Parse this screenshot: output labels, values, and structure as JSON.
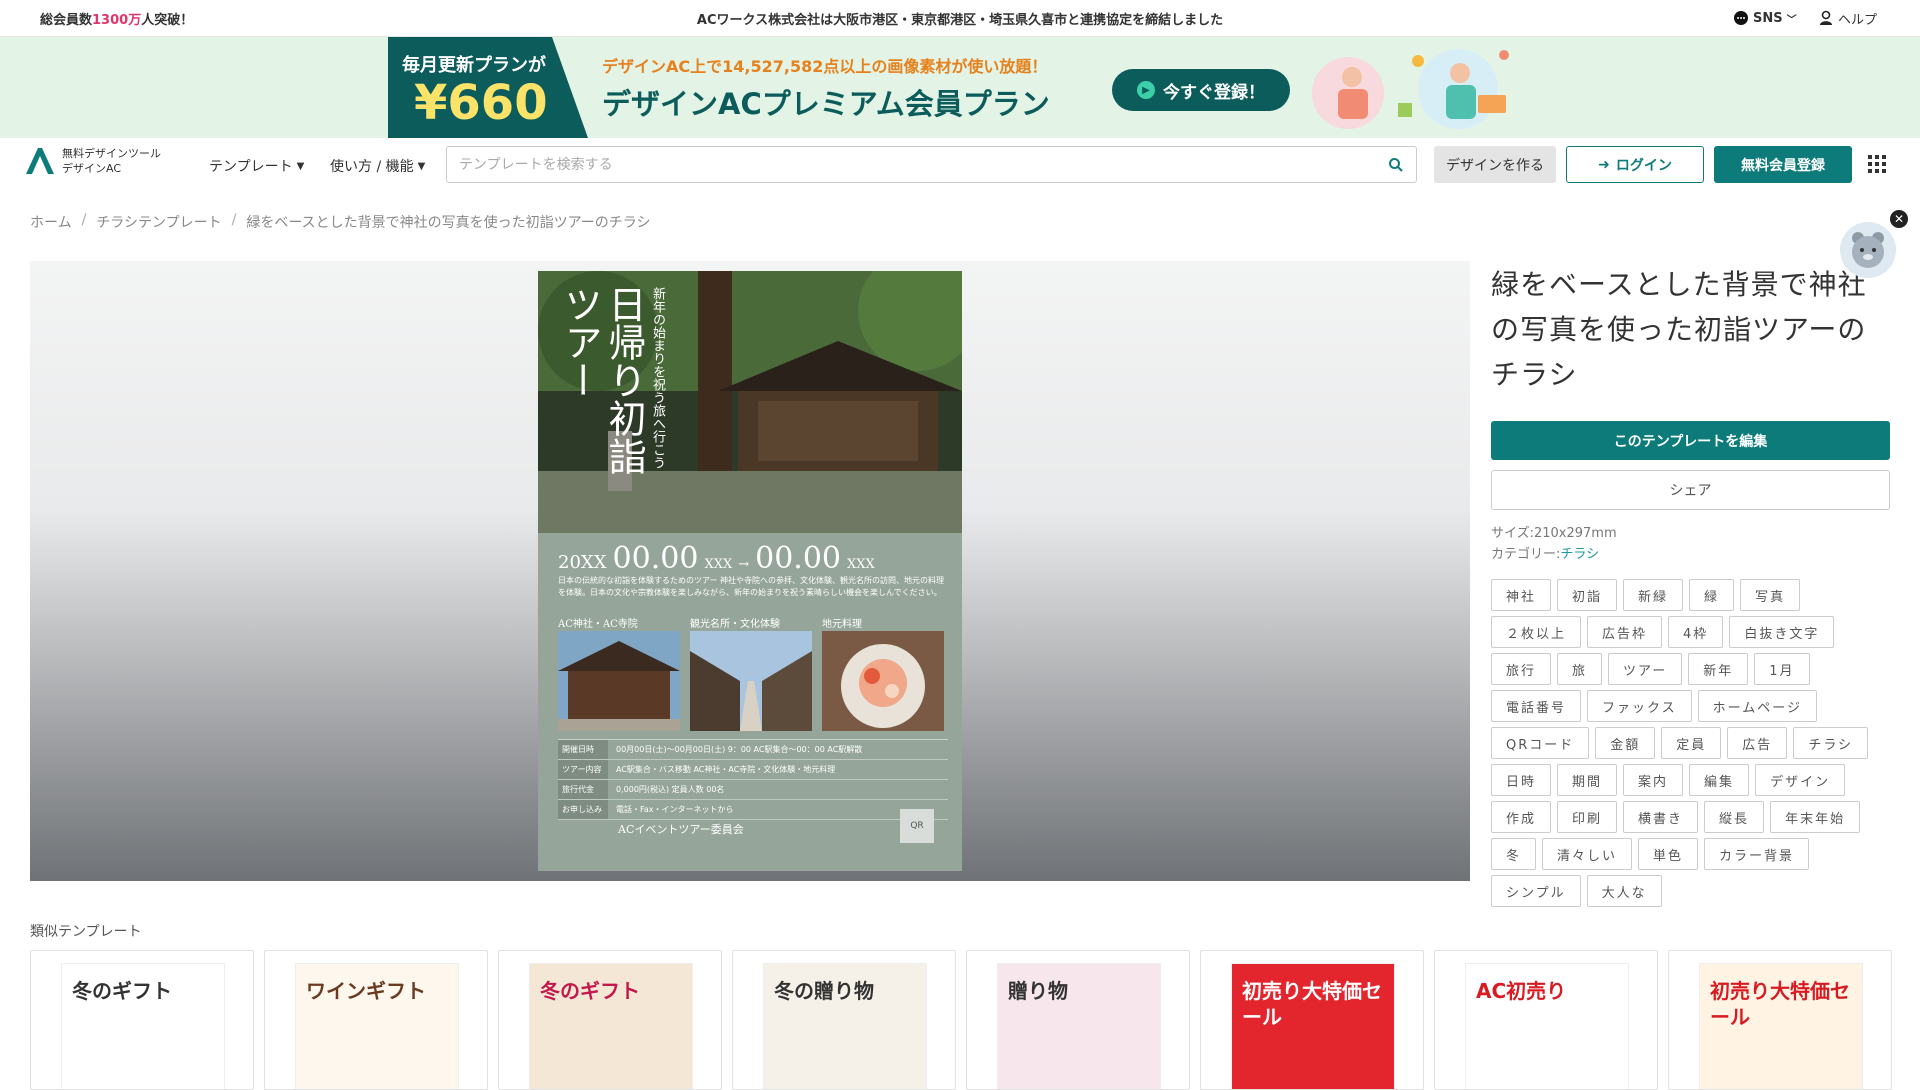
{
  "topbar": {
    "members_prefix": "総会員数",
    "members_number": "1300万",
    "members_suffix": "人突破！",
    "news": "ACワークス株式会社は大阪市港区・東京都港区・埼玉県久喜市と連携協定を締結しました",
    "sns_label": "SNS",
    "help_label": "ヘルプ"
  },
  "banner": {
    "plan_label": "毎月更新プランが",
    "price": "¥660",
    "sub": "デザインAC上で14,527,582点以上の画像素材が使い放題！",
    "title": "デザインACプレミアム会員プラン",
    "register_button": "今すぐ登録！"
  },
  "header": {
    "logo_line1": "無料デザインツール",
    "logo_line2": "デザインAC",
    "nav_templates": "テンプレート",
    "nav_howto": "使い方 / 機能",
    "search_placeholder": "テンプレートを検索する",
    "create_button": "デザインを作る",
    "login_button": "ログイン",
    "signup_button": "無料会員登録"
  },
  "breadcrumb": [
    "ホーム",
    "チラシテンプレート",
    "緑をベースとした背景で神社の写真を使った初詣ツアーのチラシ"
  ],
  "flyer": {
    "title": "日帰り初詣ツアー",
    "subtitle": "新年の始まりを祝う旅へ行こう",
    "date_year": "20XX",
    "date_start": "00.00",
    "date_sep": "XXX",
    "date_end": "00.00",
    "date_tail": "XXX",
    "desc": "日本の伝統的な初詣を体験するためのツアー 神社や寺院への参拝、文化体験、観光名所の訪問、地元の料理を体験。日本の文化や宗教体験を楽しみながら、新年の始まりを祝う素晴らしい機会を楽しんでください。",
    "pic_labels": [
      "AC神社・AC寺院",
      "観光名所・文化体験",
      "地元料理"
    ],
    "table_rows": [
      {
        "th": "開催日時",
        "td": "00月00日(土)〜00月00日(土) 9：00 AC駅集合〜00：00 AC駅解散"
      },
      {
        "th": "ツアー内容",
        "td": "AC駅集合・バス移動 AC神社・AC寺院・文化体験・地元料理"
      },
      {
        "th": "旅行代金",
        "td": "0,000円(税込) 定員人数 00名"
      },
      {
        "th": "お申し込み",
        "td": "電話・Fax・インターネットから"
      }
    ],
    "organizer": "ACイベントツアー委員会",
    "qr": "QR"
  },
  "detail": {
    "title": "緑をベースとした背景で神社の写真を使った初詣ツアーのチラシ",
    "edit_button": "このテンプレートを編集",
    "share_button": "シェア",
    "size_label": "サイズ:210x297mm",
    "category_label": "カテゴリー:",
    "category_value": "チラシ",
    "tags": [
      "神社",
      "初詣",
      "新緑",
      "緑",
      "写真",
      "２枚以上",
      "広告枠",
      "4枠",
      "白抜き文字",
      "旅行",
      "旅",
      "ツアー",
      "新年",
      "1月",
      "電話番号",
      "ファックス",
      "ホームページ",
      "QRコード",
      "金額",
      "定員",
      "広告",
      "チラシ",
      "日時",
      "期間",
      "案内",
      "編集",
      "デザイン",
      "作成",
      "印刷",
      "横書き",
      "縦長",
      "年末年始",
      "冬",
      "清々しい",
      "単色",
      "カラー背景",
      "シンプル",
      "大人な"
    ]
  },
  "similar": {
    "label": "類似テンプレート",
    "items": [
      {
        "title": "冬のギフト",
        "bg": "#ffffff",
        "fg": "#333333"
      },
      {
        "title": "ワインギフト",
        "bg": "#fdf7ee",
        "fg": "#6b3b1f"
      },
      {
        "title": "冬のギフト",
        "bg": "#f4e7d5",
        "fg": "#c2184b"
      },
      {
        "title": "冬の贈り物",
        "bg": "#f6f1e8",
        "fg": "#333333"
      },
      {
        "title": "贈り物",
        "bg": "#f7e6ec",
        "fg": "#333333"
      },
      {
        "title": "初売り大特価セール",
        "bg": "#e3262e",
        "fg": "#ffffff"
      },
      {
        "title": "AC初売り",
        "bg": "#ffffff",
        "fg": "#d81b23"
      },
      {
        "title": "初売り大特価セール",
        "bg": "#fff3e4",
        "fg": "#d81b23"
      }
    ]
  },
  "colors": {
    "brand": "#0e7b7b",
    "banner_dark": "#0b5c5b",
    "accent_pink": "#e0356b"
  }
}
